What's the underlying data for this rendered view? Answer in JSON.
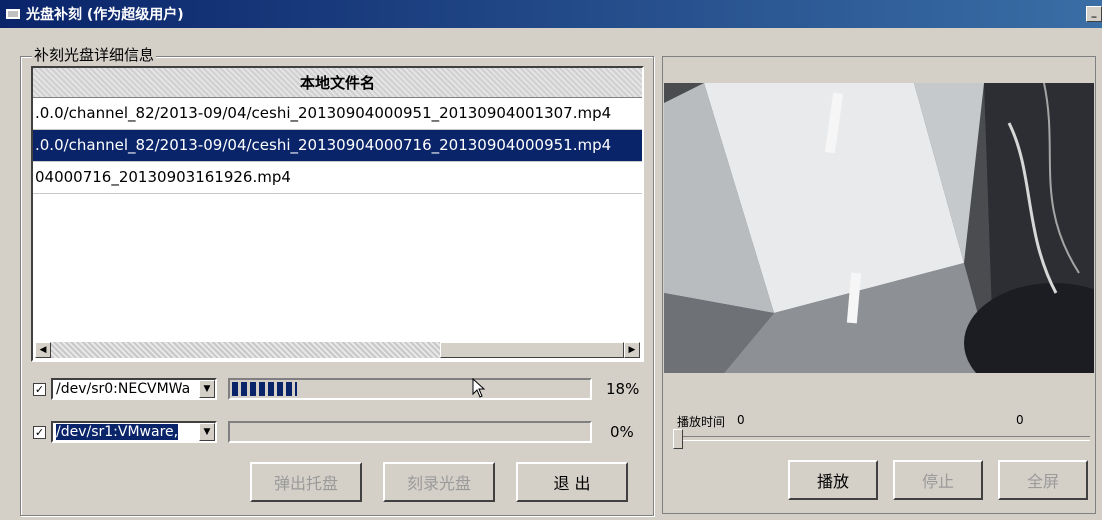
{
  "window": {
    "title": "光盘补刻 (作为超级用户)"
  },
  "details": {
    "group_title": "补刻光盘详细信息",
    "column_header": "本地文件名",
    "files": [
      ".0.0/channel_82/2013-09/04/ceshi_20130904000951_20130904001307.mp4",
      ".0.0/channel_82/2013-09/04/ceshi_20130904000716_20130904000951.mp4",
      "04000716_20130903161926.mp4"
    ],
    "selected_index": 1
  },
  "drives": [
    {
      "checked": true,
      "device": "/dev/sr0:NECVMWa",
      "progress": 0.18,
      "percent_text": "18%"
    },
    {
      "checked": true,
      "device": "/dev/sr1:VMware, ",
      "progress": 0.0,
      "percent_text": "0%"
    }
  ],
  "buttons": {
    "eject": "弹出托盘",
    "burn": "刻录光盘",
    "exit": "退 出",
    "play": "播放",
    "stop": "停止",
    "fullscreen": "全屏"
  },
  "player": {
    "time_label": "播放时间",
    "time_value": "0",
    "time_total": "0",
    "position": 0
  },
  "icons": [
    "window-icon",
    "checkbox-checked-icon",
    "dropdown-arrow-icon",
    "scroll-left-icon",
    "scroll-right-icon",
    "mouse-cursor-icon"
  ]
}
